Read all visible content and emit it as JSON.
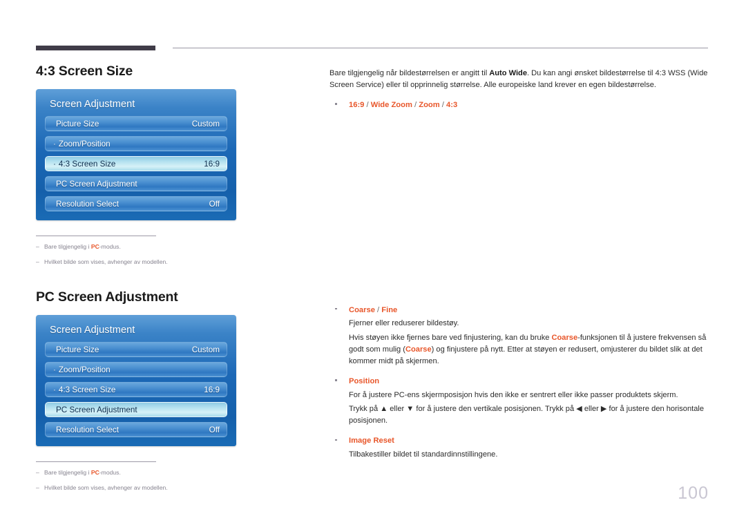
{
  "page": {
    "number": "100",
    "language": "Norwegian"
  },
  "sections": [
    {
      "heading": "4:3 Screen Size",
      "osd": {
        "title": "Screen Adjustment",
        "rows": [
          {
            "bullet": "",
            "label": "Picture Size",
            "value": "Custom",
            "selected": false
          },
          {
            "bullet": "·",
            "label": "Zoom/Position",
            "value": "",
            "selected": false
          },
          {
            "bullet": "·",
            "label": "4:3 Screen Size",
            "value": "16:9",
            "selected": true
          },
          {
            "bullet": "",
            "label": "PC Screen Adjustment",
            "value": "",
            "selected": false
          },
          {
            "bullet": "",
            "label": "Resolution Select",
            "value": "Off",
            "selected": false
          }
        ]
      },
      "notes": [
        {
          "dash": "–",
          "pre": "Bare tilgjengelig i ",
          "bold": "PC",
          "post": "-modus."
        },
        {
          "dash": "–",
          "pre": "Hvilket bilde som vises, avhenger av modellen.",
          "bold": "",
          "post": ""
        }
      ]
    },
    {
      "heading": "PC Screen Adjustment",
      "osd": {
        "title": "Screen Adjustment",
        "rows": [
          {
            "bullet": "",
            "label": "Picture Size",
            "value": "Custom",
            "selected": false
          },
          {
            "bullet": "·",
            "label": "Zoom/Position",
            "value": "",
            "selected": false
          },
          {
            "bullet": "·",
            "label": "4:3 Screen Size",
            "value": "16:9",
            "selected": false
          },
          {
            "bullet": "",
            "label": "PC Screen Adjustment",
            "value": "",
            "selected": true
          },
          {
            "bullet": "",
            "label": "Resolution Select",
            "value": "Off",
            "selected": false
          }
        ]
      },
      "notes": [
        {
          "dash": "–",
          "pre": "Bare tilgjengelig i ",
          "bold": "PC",
          "post": "-modus."
        },
        {
          "dash": "–",
          "pre": "Hvilket bilde som vises, avhenger av modellen.",
          "bold": "",
          "post": ""
        }
      ]
    }
  ],
  "right_column": {
    "intro": {
      "part1": "Bare tilgjengelig når bildestørrelsen er angitt til ",
      "bold1": "Auto Wide",
      "part2": ". Du kan angi ønsket bildestørrelse til 4:3 WSS (Wide Screen Service) eller til opprinnelig størrelse. Alle europeiske land krever en egen bildestørrelse."
    },
    "options_bullet": {
      "opt1": "16:9",
      "sep1": " / ",
      "opt2": "Wide Zoom",
      "sep2": " / ",
      "opt3": "Zoom",
      "sep3": " / ",
      "opt4": "4:3"
    },
    "pc_bullets": [
      {
        "head_main": "Coarse",
        "head_sep": " / ",
        "head_alt": "Fine",
        "lines": [
          "Fjerner eller reduserer bildestøy.",
          "Hvis støyen ikke fjernes bare ved finjustering, kan du bruke Coarse-funksjonen til å justere frekvensen så godt som mulig (Coarse) og finjustere på nytt. Etter at støyen er redusert, omjusterer du bildet slik at det kommer midt på skjermen."
        ]
      },
      {
        "head_main": "Position",
        "head_sep": "",
        "head_alt": "",
        "lines": [
          "For å justere PC-ens skjermposisjon hvis den ikke er sentrert eller ikke passer produktets skjerm.",
          "Trykk på ▲ eller ▼ for å justere den vertikale posisjonen. Trykk på ◀ eller ▶ for å justere den horisontale posisjonen."
        ]
      },
      {
        "head_main": "Image Reset",
        "head_sep": "",
        "head_alt": "",
        "lines": [
          "Tilbakestiller bildet til standardinnstillingene."
        ]
      }
    ]
  },
  "colors": {
    "accent_orange": "#e8562a",
    "osd_blue": "#1c68b6",
    "osd_selected": "#b7e3f0",
    "rule_dark": "#403c48",
    "note_gray": "#86838f",
    "page_number_gray": "#c9c6d2"
  }
}
